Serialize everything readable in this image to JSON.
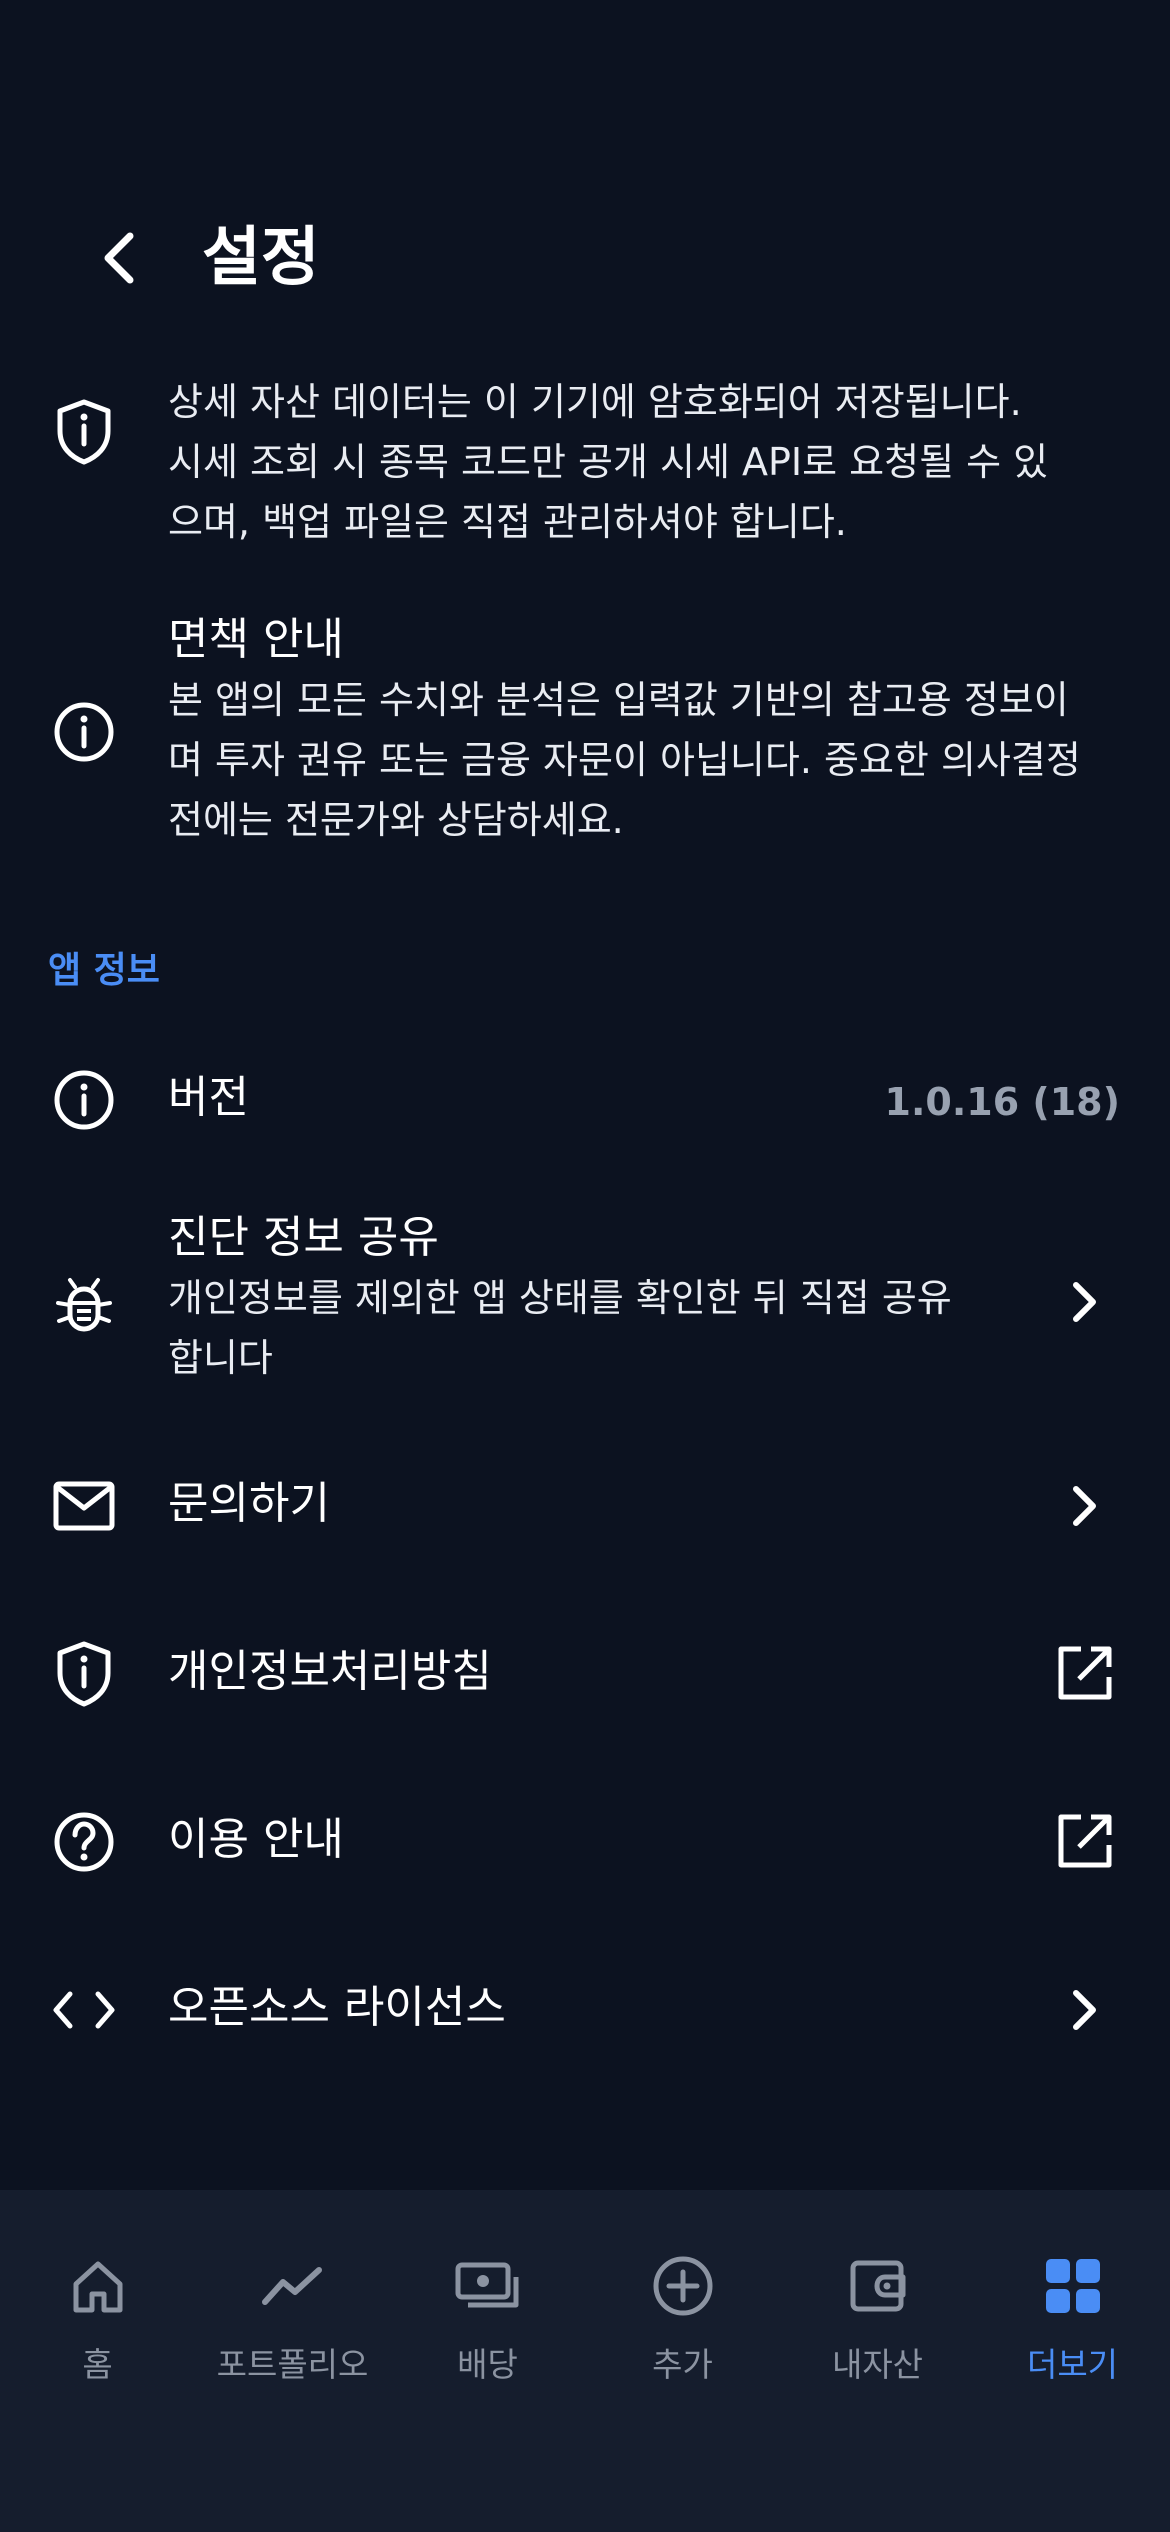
{
  "header": {
    "title": "설정"
  },
  "privacy_note": {
    "lines": [
      "상세 자산 데이터는 이 기기에 암호화되어 저장됩니다.",
      "시세 조회 시 종목 코드만 공개 시세 API로 요청될 수 있",
      "으며, 백업 파일은 직접 관리하셔야 합니다."
    ]
  },
  "disclaimer": {
    "title": "면책 안내",
    "lines": [
      "본 앱의 모든 수치와 분석은 입력값 기반의 참고용 정보이",
      "며 투자 권유 또는 금융 자문이 아닙니다. 중요한 의사결정",
      "전에는 전문가와 상담하세요."
    ]
  },
  "app_info": {
    "section_label": "앱 정보",
    "version": {
      "label": "버전",
      "value": "1.0.16 (18)"
    },
    "diagnostics": {
      "label": "진단 정보 공유",
      "lines": [
        "개인정보를 제외한 앱 상태를 확인한 뒤 직접 공유",
        "합니다"
      ]
    },
    "contact": {
      "label": "문의하기"
    },
    "privacy_policy": {
      "label": "개인정보처리방침"
    },
    "guide": {
      "label": "이용 안내"
    },
    "licenses": {
      "label": "오픈소스 라이선스"
    }
  },
  "tabbar": {
    "tabs": [
      {
        "label": "홈",
        "icon": "home-icon"
      },
      {
        "label": "포트폴리오",
        "icon": "trend-line-icon"
      },
      {
        "label": "배당",
        "icon": "cash-stack-icon"
      },
      {
        "label": "추가",
        "icon": "plus-circle-icon"
      },
      {
        "label": "내자산",
        "icon": "wallet-icon"
      },
      {
        "label": "더보기",
        "icon": "grid-icon",
        "active": true
      }
    ]
  },
  "colors": {
    "background": "#0c1220",
    "tabbar_bg": "#151d2d",
    "accent": "#4a8df5",
    "muted": "#8b93a1"
  }
}
